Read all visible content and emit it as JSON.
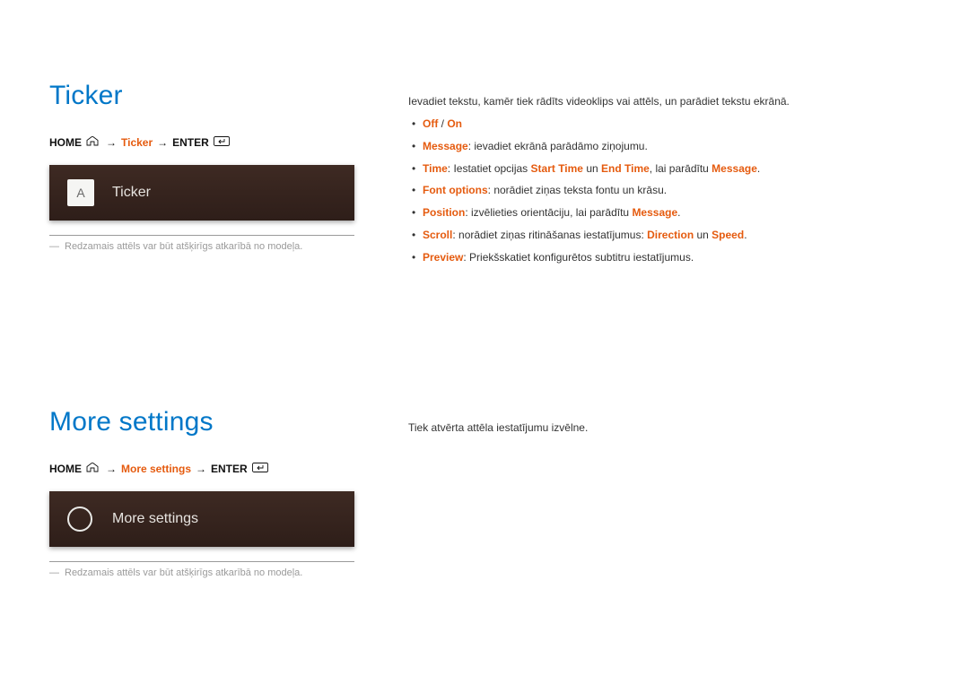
{
  "section1": {
    "title": "Ticker",
    "breadcrumb": {
      "home": "HOME",
      "mid": "Ticker",
      "enter": "ENTER"
    },
    "card_letter": "A",
    "card_label": "Ticker",
    "footnote": "Redzamais attēls var būt atšķirīgs atkarībā no modeļa.",
    "right_intro": "Ievadiet tekstu, kamēr tiek rādīts videoklips vai attēls, un parādiet tekstu ekrānā.",
    "bullets": {
      "b0": {
        "hl1": "Off",
        "sep": " / ",
        "hl2": "On"
      },
      "b1": {
        "hl1": "Message",
        "rest": ": ievadiet ekrānā parādāmo ziņojumu."
      },
      "b2": {
        "hl1": "Time",
        "t1": ": Iestatiet opcijas ",
        "hl2": "Start Time",
        "t2": " un ",
        "hl3": "End Time",
        "t3": ", lai parādītu ",
        "hl4": "Message",
        "t4": "."
      },
      "b3": {
        "hl1": "Font options",
        "rest": ": norādiet ziņas teksta fontu un krāsu."
      },
      "b4": {
        "hl1": "Position",
        "t1": ": izvēlieties orientāciju, lai parādītu ",
        "hl2": "Message",
        "t2": "."
      },
      "b5": {
        "hl1": "Scroll",
        "t1": ": norādiet ziņas ritināšanas iestatījumus: ",
        "hl2": "Direction",
        "t2": " un ",
        "hl3": "Speed",
        "t3": "."
      },
      "b6": {
        "hl1": "Preview",
        "rest": ": Priekšskatiet konfigurētos subtitru iestatījumus."
      }
    }
  },
  "section2": {
    "title": "More settings",
    "breadcrumb": {
      "home": "HOME",
      "mid": "More settings",
      "enter": "ENTER"
    },
    "card_label": "More settings",
    "footnote": "Redzamais attēls var būt atšķirīgs atkarībā no modeļa.",
    "right_intro": "Tiek atvērta attēla iestatījumu izvēlne."
  }
}
